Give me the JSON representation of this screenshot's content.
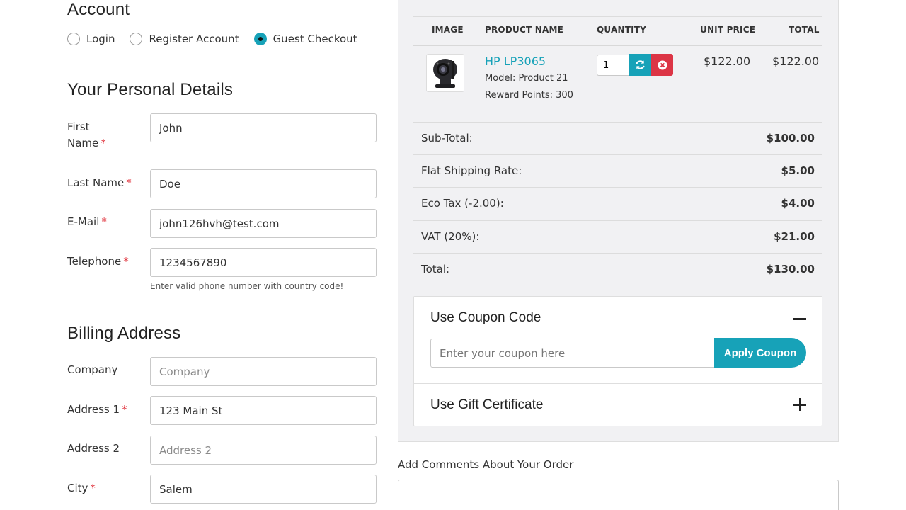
{
  "account": {
    "title": "Account",
    "options": [
      {
        "label": "Login",
        "selected": false
      },
      {
        "label": "Register Account",
        "selected": false
      },
      {
        "label": "Guest Checkout",
        "selected": true
      }
    ]
  },
  "personal": {
    "title": "Your Personal Details",
    "first_name": {
      "label": "First Name",
      "value": "John"
    },
    "last_name": {
      "label": "Last Name",
      "value": "Doe"
    },
    "email": {
      "label": "E-Mail",
      "value": "john126hvh@test.com"
    },
    "telephone": {
      "label": "Telephone",
      "value": "1234567890",
      "help": "Enter valid phone number with country code!"
    }
  },
  "billing": {
    "title": "Billing Address",
    "company": {
      "label": "Company",
      "value": "",
      "placeholder": "Company"
    },
    "address1": {
      "label": "Address 1",
      "value": "123 Main St"
    },
    "address2": {
      "label": "Address 2",
      "value": "",
      "placeholder": "Address 2"
    },
    "city": {
      "label": "City",
      "value": "Salem"
    }
  },
  "cart": {
    "headers": {
      "image": "IMAGE",
      "name": "PRODUCT NAME",
      "quantity": "QUANTITY",
      "unit_price": "UNIT PRICE",
      "total": "TOTAL"
    },
    "items": [
      {
        "name": "HP LP3065",
        "model": "Model: Product 21",
        "reward": "Reward Points: 300",
        "quantity": "1",
        "unit_price": "$122.00",
        "total": "$122.00",
        "image_icon": "camera-icon"
      }
    ],
    "totals": [
      {
        "label": "Sub-Total:",
        "value": "$100.00"
      },
      {
        "label": "Flat Shipping Rate:",
        "value": "$5.00"
      },
      {
        "label": "Eco Tax (-2.00):",
        "value": "$4.00"
      },
      {
        "label": "VAT (20%):",
        "value": "$21.00"
      },
      {
        "label": "Total:",
        "value": "$130.00"
      }
    ]
  },
  "coupon": {
    "title": "Use Coupon Code",
    "placeholder": "Enter your coupon here",
    "button": "Apply Coupon"
  },
  "gift": {
    "title": "Use Gift Certificate"
  },
  "comments": {
    "label": "Add Comments About Your Order"
  },
  "colors": {
    "accent": "#17a2b8",
    "danger": "#dc3545",
    "required": "#e0313b"
  }
}
